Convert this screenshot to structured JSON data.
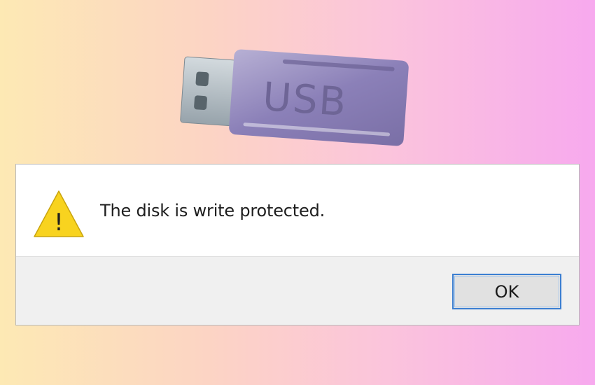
{
  "illustration": {
    "usb_label": "USB",
    "body_color": "#8a7fb3",
    "connector_color": "#b4bfc6"
  },
  "dialog": {
    "icon": "warning-icon",
    "icon_glyph": "!",
    "icon_color": "#f7d21c",
    "message": "The disk is write protected.",
    "ok_label": "OK",
    "accent_color": "#3c7fd1"
  }
}
